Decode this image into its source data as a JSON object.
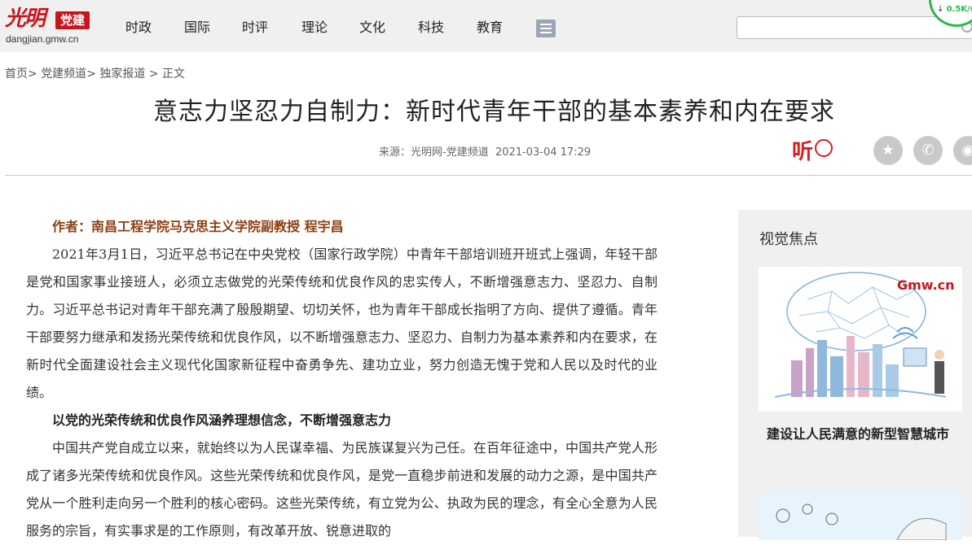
{
  "logo": {
    "glyph": "光明",
    "badge": "党建",
    "domain": "dangjian.gmw.cn"
  },
  "nav": {
    "items": [
      "时政",
      "国际",
      "时评",
      "理论",
      "文化",
      "科技",
      "教育"
    ]
  },
  "search": {
    "placeholder": ""
  },
  "speed": {
    "text": "0.5K/s"
  },
  "breadcrumb": {
    "home": "首页",
    "channel": "党建频道",
    "section": "独家报道",
    "current": "正文"
  },
  "article": {
    "title": "意志力坚忍力自制力：新时代青年干部的基本素养和内在要求",
    "source": "来源：光明网-党建频道",
    "date": "2021-03-04 17:29",
    "listen_label": "听",
    "author": "作者：南昌工程学院马克思主义学院副教授 程宇昌",
    "para1": "2021年3月1日，习近平总书记在中央党校（国家行政学院）中青年干部培训班开班式上强调，年轻干部是党和国家事业接班人，必须立志做党的光荣传统和优良作风的忠实传人，不断增强意志力、坚忍力、自制力。习近平总书记对青年干部充满了殷殷期望、切切关怀，也为青年干部成长指明了方向、提供了遵循。青年干部要努力继承和发扬光荣传统和优良作风，以不断增强意志力、坚忍力、自制力为基本素养和内在要求，在新时代全面建设社会主义现代化国家新征程中奋勇争先、建功立业，努力创造无愧于党和人民以及时代的业绩。",
    "subhead1": "以党的光荣传统和优良作风涵养理想信念，不断增强意志力",
    "para2": "中国共产党自成立以来，就始终以为人民谋幸福、为民族谋复兴为己任。在百年征途中，中国共产党人形成了诸多光荣传统和优良作风。这些光荣传统和优良作风，是党一直稳步前进和发展的动力之源，是中国共产党从一个胜利走向另一个胜利的核心密码。这些光荣传统，有立党为公、执政为民的理念，有全心全意为人民服务的宗旨，有实事求是的工作原则，有改革开放、锐意进取的"
  },
  "sidebar": {
    "title": "视觉焦点",
    "img_logo": "Gmw.cn",
    "caption": "建设让人民满意的新型智慧城市"
  },
  "colors": {
    "brand_red": "#c8161d",
    "author_brown": "#8b3e12",
    "speed_green": "#2db84a"
  }
}
